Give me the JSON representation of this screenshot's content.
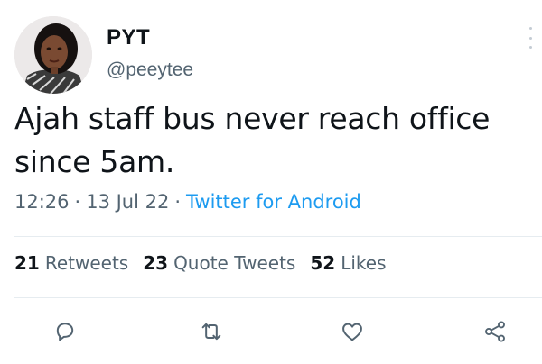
{
  "tweet": {
    "display_name": "PYT",
    "handle": "@peeytee",
    "text": "Ajah staff bus never reach office since 5am.",
    "time": "12:26",
    "date": "13 Jul 22",
    "source": "Twitter for Android",
    "separator": "·"
  },
  "stats": {
    "retweets": {
      "count": "21",
      "label": "Retweets"
    },
    "quote_tweets": {
      "count": "23",
      "label": "Quote Tweets"
    },
    "likes": {
      "count": "52",
      "label": "Likes"
    }
  },
  "colors": {
    "text": "#0f1419",
    "secondary": "#536471",
    "link": "#1d9bf0",
    "divider": "#e6ecf0"
  },
  "icons": {
    "reply": "reply-icon",
    "retweet": "retweet-icon",
    "like": "like-icon",
    "share": "share-icon",
    "more": "more-icon"
  }
}
